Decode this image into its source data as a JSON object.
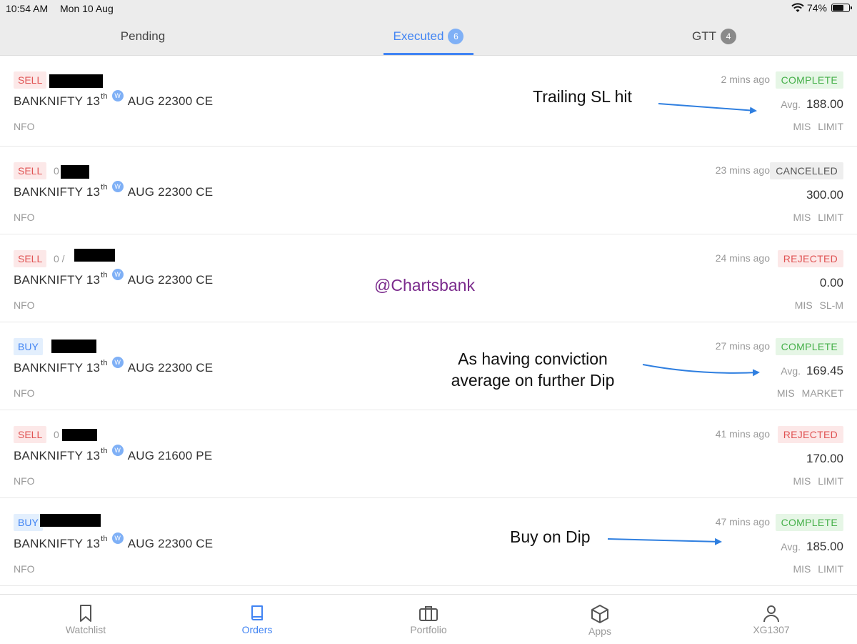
{
  "status_bar": {
    "time": "10:54 AM",
    "date": "Mon 10 Aug",
    "battery": "74%",
    "battery_level": 0.74
  },
  "tabs": [
    {
      "label": "Pending",
      "count": ""
    },
    {
      "label": "Executed",
      "count": "6"
    },
    {
      "label": "GTT",
      "count": "4"
    }
  ],
  "orders": [
    {
      "side": "SELL",
      "qty": "",
      "instrument": "BANKNIFTY 13",
      "suffix": "th",
      "weekly": "W",
      "contract": "AUG 22300 CE",
      "exchange": "NFO",
      "time_ago": "2 mins ago",
      "status": "COMPLETE",
      "avg_label": "Avg.",
      "price": "188.00",
      "product": "MIS",
      "type": "LIMIT"
    },
    {
      "side": "SELL",
      "qty": "0",
      "instrument": "BANKNIFTY 13",
      "suffix": "th",
      "weekly": "W",
      "contract": "AUG 22300 CE",
      "exchange": "NFO",
      "time_ago": "23 mins ago",
      "status": "CANCELLED",
      "avg_label": "",
      "price": "300.00",
      "product": "MIS",
      "type": "LIMIT"
    },
    {
      "side": "SELL",
      "qty": "0 /",
      "instrument": "BANKNIFTY 13",
      "suffix": "th",
      "weekly": "W",
      "contract": "AUG 22300 CE",
      "exchange": "NFO",
      "time_ago": "24 mins ago",
      "status": "REJECTED",
      "avg_label": "",
      "price": "0.00",
      "product": "MIS",
      "type": "SL-M"
    },
    {
      "side": "BUY",
      "qty": "",
      "instrument": "BANKNIFTY 13",
      "suffix": "th",
      "weekly": "W",
      "contract": "AUG 22300 CE",
      "exchange": "NFO",
      "time_ago": "27 mins ago",
      "status": "COMPLETE",
      "avg_label": "Avg.",
      "price": "169.45",
      "product": "MIS",
      "type": "MARKET"
    },
    {
      "side": "SELL",
      "qty": "0",
      "instrument": "BANKNIFTY 13",
      "suffix": "th",
      "weekly": "W",
      "contract": "AUG 21600 PE",
      "exchange": "NFO",
      "time_ago": "41 mins ago",
      "status": "REJECTED",
      "avg_label": "",
      "price": "170.00",
      "product": "MIS",
      "type": "LIMIT"
    },
    {
      "side": "BUY",
      "qty": "",
      "instrument": "BANKNIFTY 13",
      "suffix": "th",
      "weekly": "W",
      "contract": "AUG 22300 CE",
      "exchange": "NFO",
      "time_ago": "47 mins ago",
      "status": "COMPLETE",
      "avg_label": "Avg.",
      "price": "185.00",
      "product": "MIS",
      "type": "LIMIT"
    }
  ],
  "annotations": {
    "trailing": "Trailing SL hit",
    "conviction_line1": "As having conviction",
    "conviction_line2": "average on further Dip",
    "buy_dip": "Buy on Dip",
    "watermark": "@Chartsbank"
  },
  "colors": {
    "accent": "#4184f3",
    "sell": "#e05353",
    "complete": "#46b04a",
    "annotation_arrow": "#2f7fe0",
    "watermark": "#7a2a8c"
  },
  "bottom_nav": [
    {
      "label": "Watchlist",
      "icon": "bookmark-icon",
      "active": false
    },
    {
      "label": "Orders",
      "icon": "book-icon",
      "active": true
    },
    {
      "label": "Portfolio",
      "icon": "briefcase-icon",
      "active": false
    },
    {
      "label": "Apps",
      "icon": "cube-icon",
      "active": false
    },
    {
      "label": "XG1307",
      "icon": "user-icon",
      "active": false
    }
  ]
}
